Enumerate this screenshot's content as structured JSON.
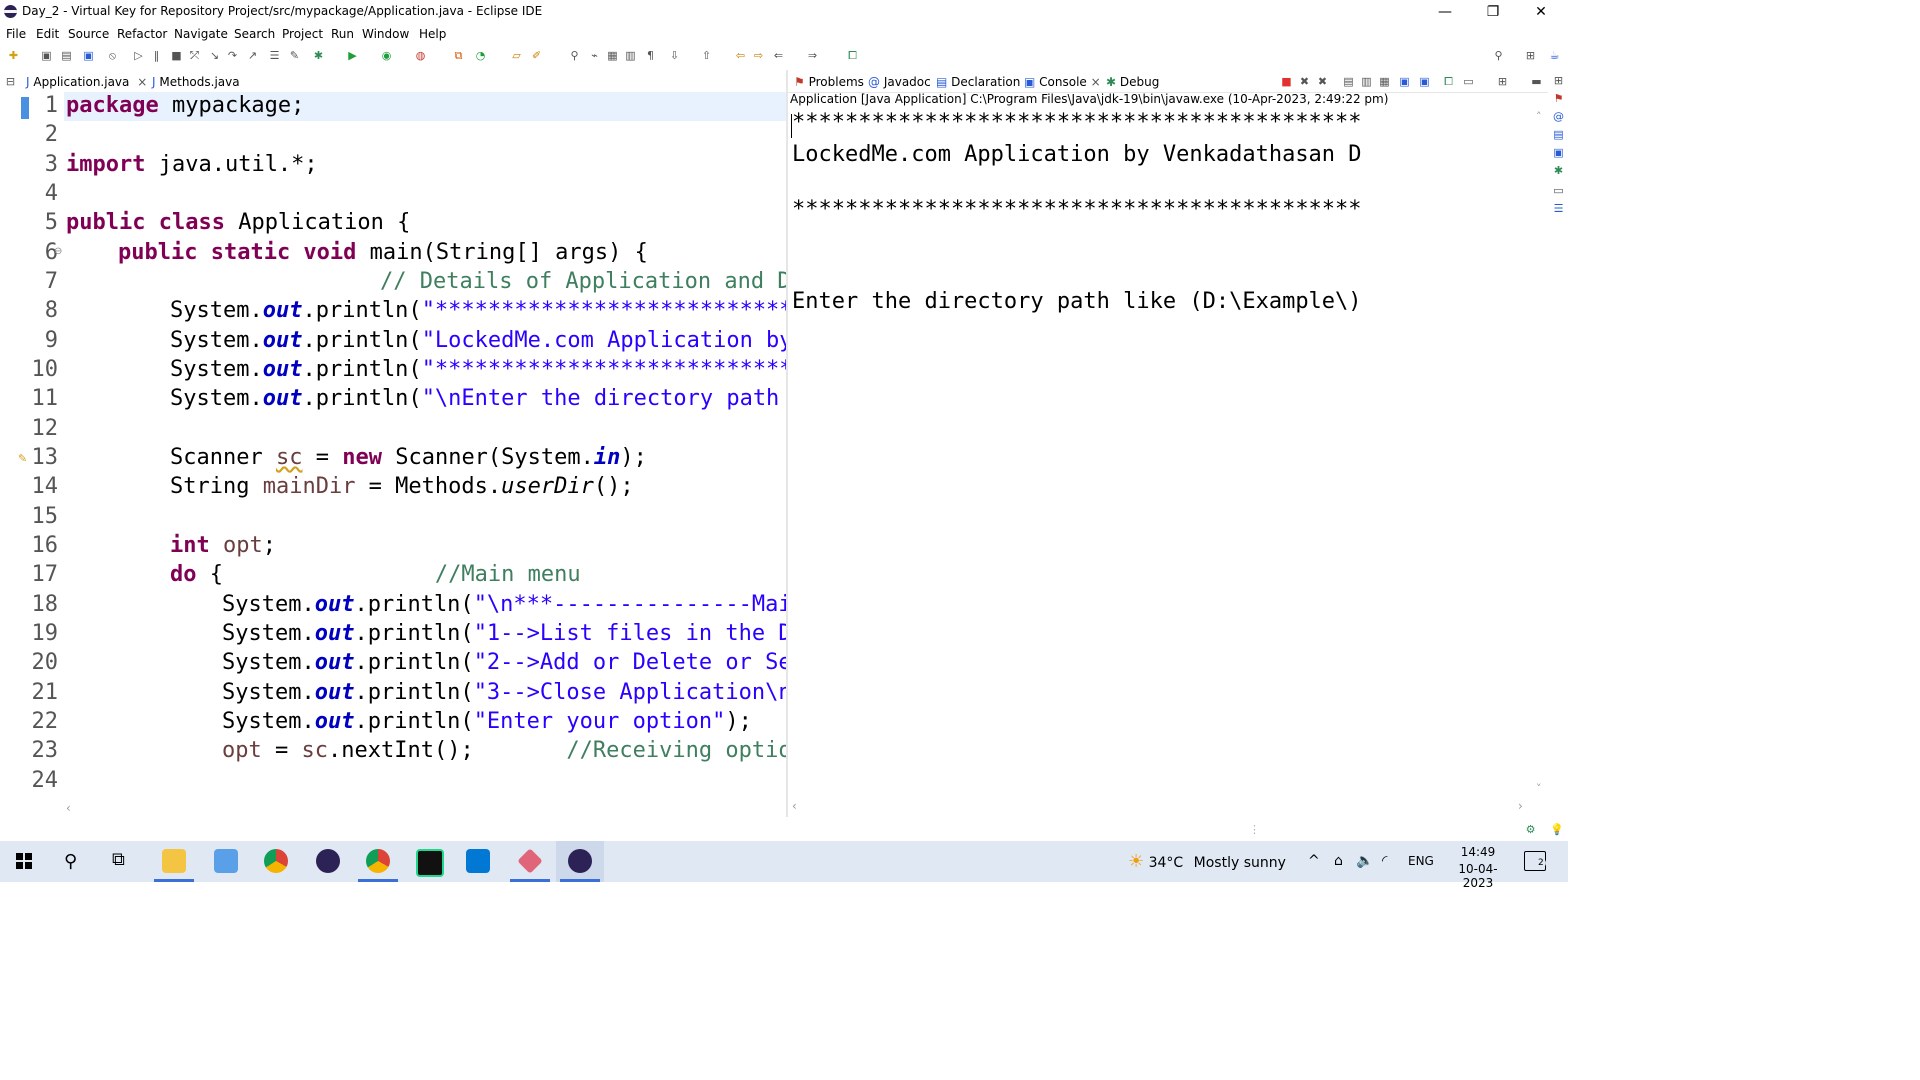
{
  "window": {
    "title": "Day_2 - Virtual Key for Repository Project/src/mypackage/Application.java - Eclipse IDE",
    "minimize": "—",
    "restore": "❐",
    "close": "✕"
  },
  "menu": [
    "File",
    "Edit",
    "Source",
    "Refactor",
    "Navigate",
    "Search",
    "Project",
    "Run",
    "Window",
    "Help"
  ],
  "editor": {
    "tabs": [
      {
        "label": "Application.java",
        "close": "×"
      },
      {
        "label": "Methods.java"
      }
    ],
    "lines": [
      {
        "n": "1"
      },
      {
        "n": "2"
      },
      {
        "n": "3"
      },
      {
        "n": "4"
      },
      {
        "n": "5"
      },
      {
        "n": "6"
      },
      {
        "n": "7"
      },
      {
        "n": "8"
      },
      {
        "n": "9"
      },
      {
        "n": "10"
      },
      {
        "n": "11"
      },
      {
        "n": "12"
      },
      {
        "n": "13"
      },
      {
        "n": "14"
      },
      {
        "n": "15"
      },
      {
        "n": "16"
      },
      {
        "n": "17"
      },
      {
        "n": "18"
      },
      {
        "n": "19"
      },
      {
        "n": "20"
      },
      {
        "n": "21"
      },
      {
        "n": "22"
      },
      {
        "n": "23"
      },
      {
        "n": "24"
      }
    ],
    "code": {
      "l1_kw": "package",
      "l1_rest": " mypackage;",
      "l3_kw": "import",
      "l3_rest": " java.util.*;",
      "l5_kw": "public class",
      "l5_rest": " Application {",
      "l6_kw": "public static void",
      "l6_rest": " main(String[] args) {",
      "l7_cm": "// Details of Application and D",
      "sys": "System.",
      "out": "out",
      "println": ".println(",
      "l8_str": "\"***************************",
      "l9_str": "\"LockedMe.com Application by",
      "l10_str": "\"***************************",
      "l11_str": "\"\\nEnter the directory path ",
      "l13_a": "Scanner ",
      "l13_sc": "sc",
      "l13_b": " = ",
      "l13_new": "new",
      "l13_c": " Scanner(System.",
      "l13_in": "in",
      "l13_d": ");",
      "l14_a": "String ",
      "l14_var": "mainDir",
      "l14_b": " = Methods.",
      "l14_m": "userDir",
      "l14_c": "();",
      "l16_kw": "int",
      "l16_var": " opt",
      "l16_rest": ";",
      "l17_kw": "do",
      "l17_rest": " {                ",
      "l17_cm": "//Main menu",
      "l18_str": "\"\\n***---------------Mai",
      "l19_str": "\"1-->List files in the D",
      "l20_str": "\"2-->Add or Delete or Se",
      "l21_str": "\"3-->Close Application\\n",
      "l22_str": "\"Enter your option\"",
      "l22_end": ");",
      "l23_var": "opt",
      "l23_a": " = ",
      "l23_sc": "sc",
      "l23_b": ".nextInt();       ",
      "l23_cm": "//Receiving optio"
    }
  },
  "views": {
    "tabs": [
      "Problems",
      "Javadoc",
      "Declaration",
      "Console",
      "Debug"
    ],
    "console_close": "×",
    "console_header": "Application [Java Application] C:\\Program Files\\Java\\jdk-19\\bin\\javaw.exe  (10-Apr-2023, 2:49:22 pm)",
    "output": [
      "*******************************************",
      "LockedMe.com Application by Venkadathasan D",
      "*******************************************",
      "Enter the directory path like (D:\\Example\\)"
    ]
  },
  "taskbar": {
    "weather_temp": "34°C",
    "weather_desc": "Mostly sunny",
    "lang": "ENG",
    "time": "14:49",
    "date": "10-04-2023",
    "notifications": "2"
  },
  "colors": {
    "keyword": "#7f0055",
    "string": "#2a00ff",
    "comment": "#3f7f5f",
    "field": "#0000c0",
    "current_line": "#e8f2fe",
    "taskbar": "#dfe8f3"
  }
}
